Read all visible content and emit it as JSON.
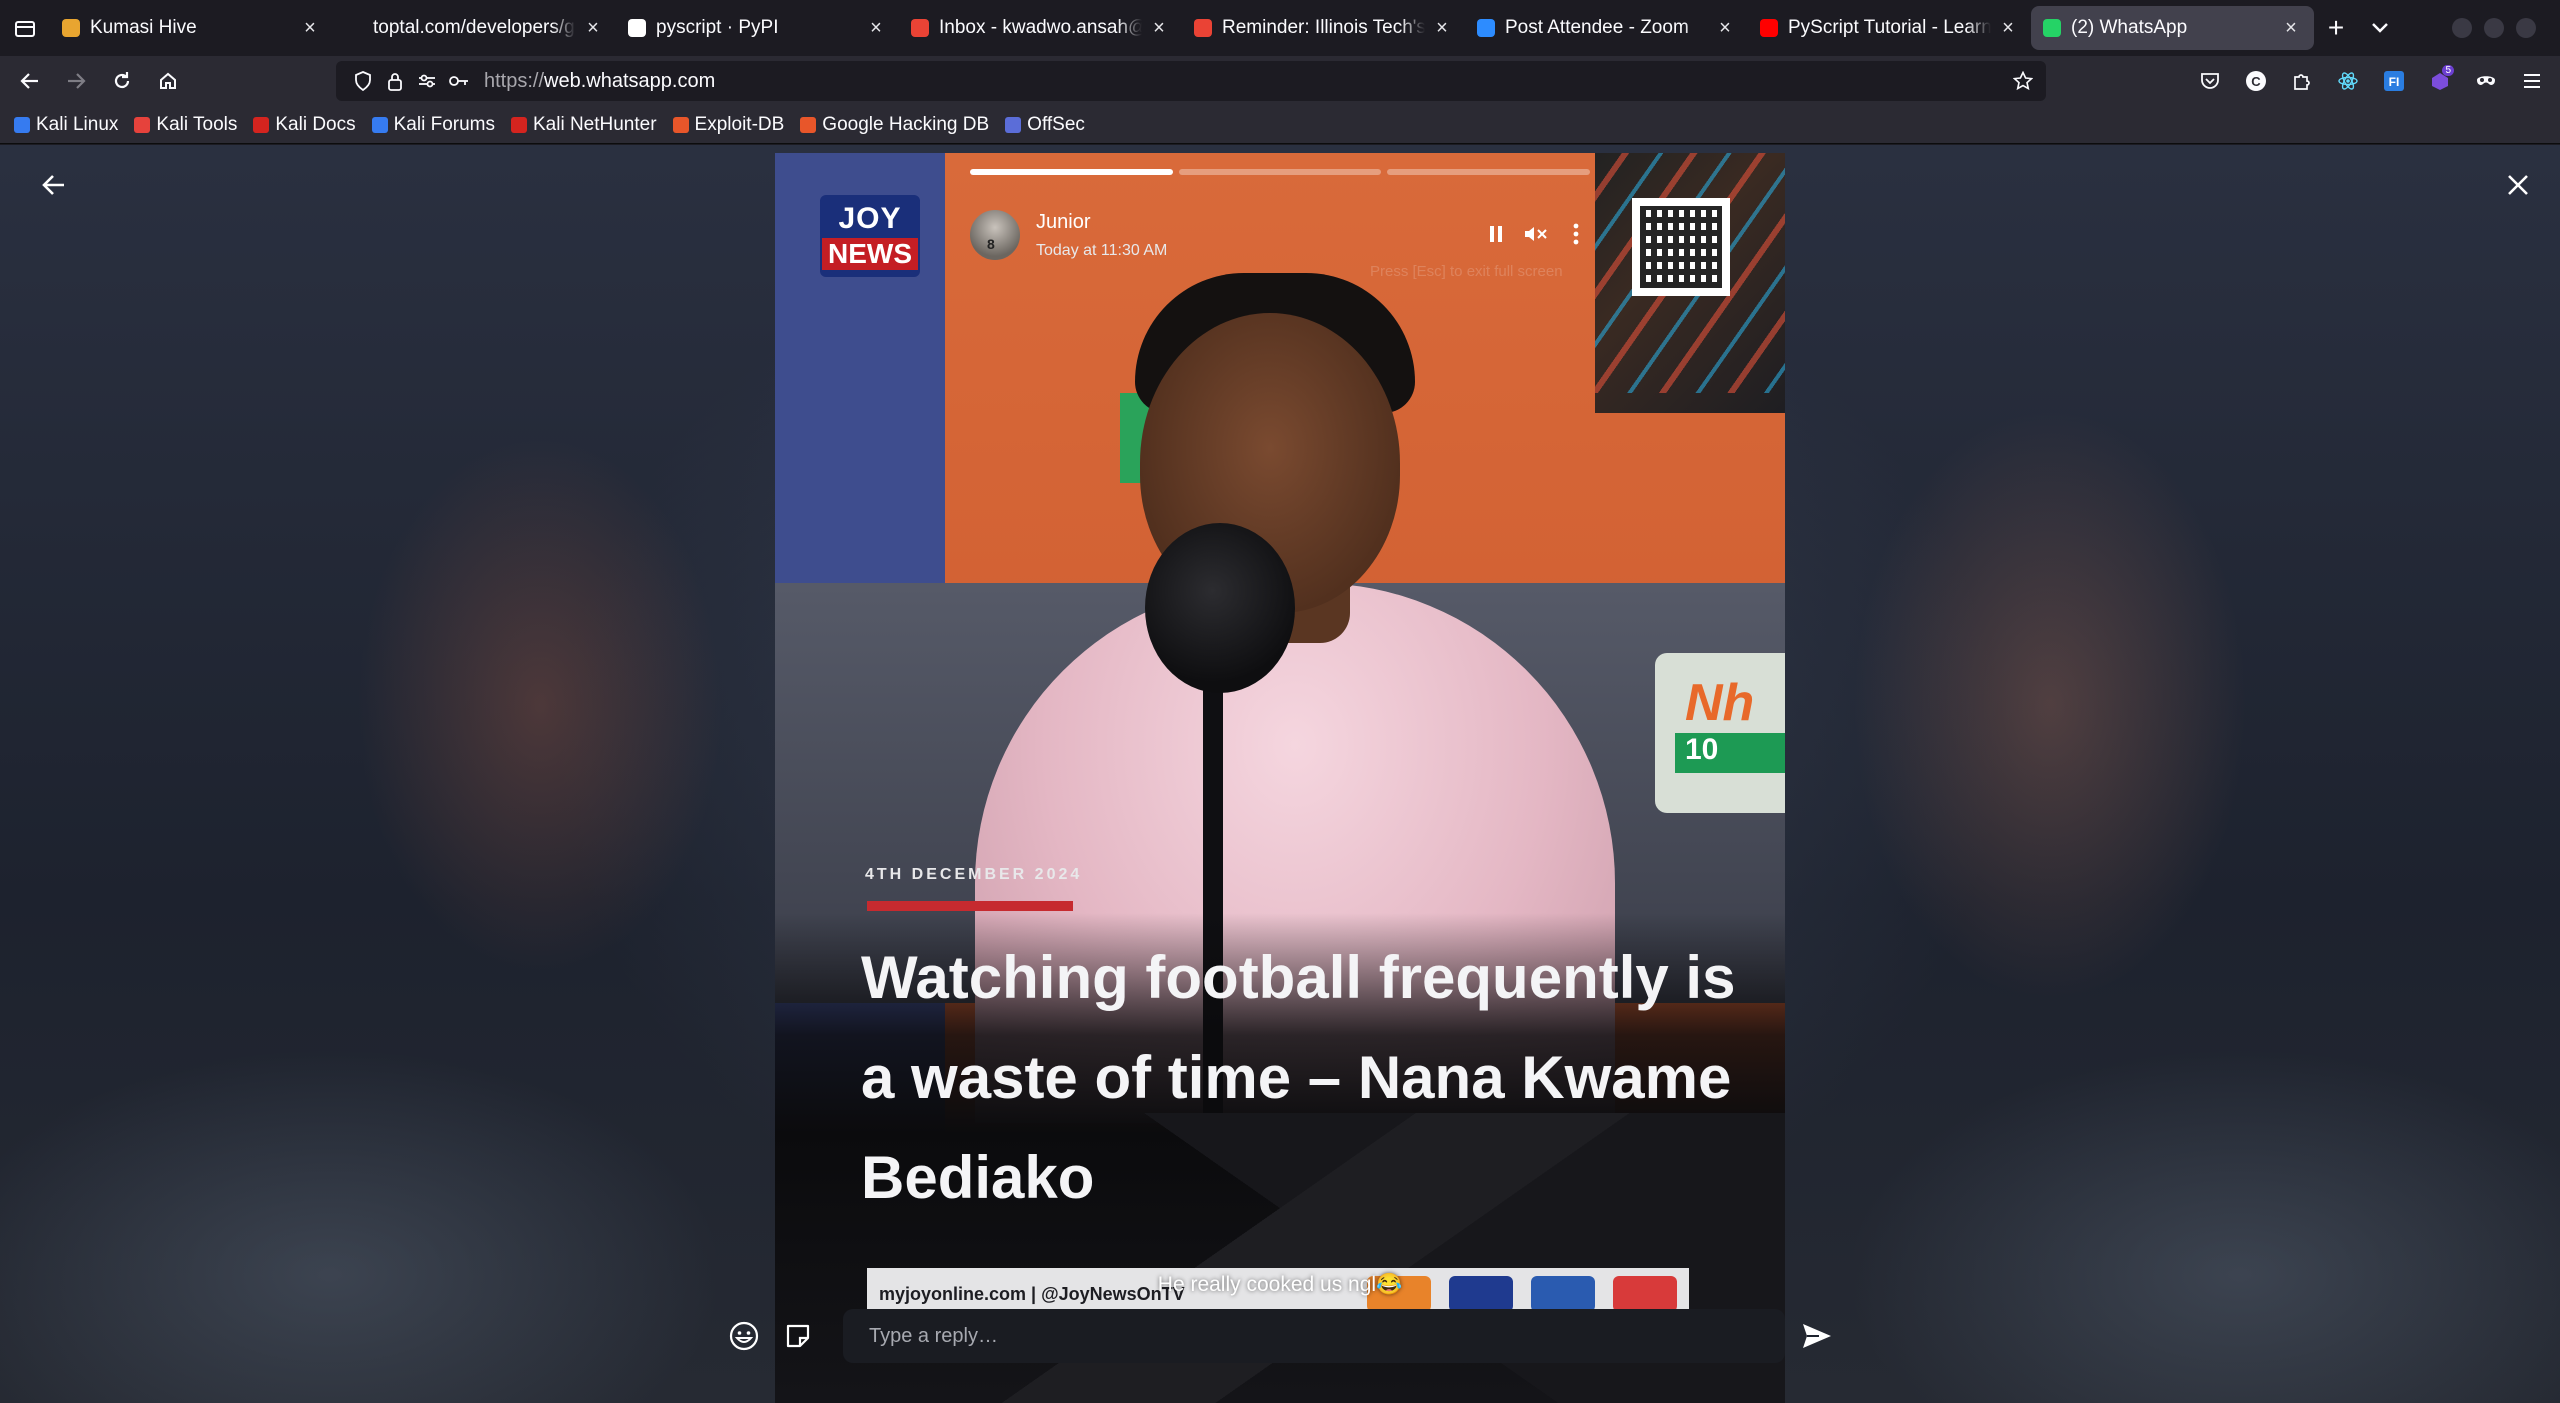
{
  "browser": {
    "tabs": [
      {
        "title": "Kumasi Hive",
        "favicon": "hive-favicon",
        "color": "#e8a530",
        "active": false
      },
      {
        "title": "toptal.com/developers/gitign",
        "favicon": "none",
        "color": "#1c1b22",
        "active": false
      },
      {
        "title": "pyscript · PyPI",
        "favicon": "pypi-favicon",
        "color": "#ffffff",
        "active": false
      },
      {
        "title": "Inbox - kwadwo.ansah@",
        "favicon": "gmail-favicon",
        "color": "#ea4335",
        "active": false
      },
      {
        "title": "Reminder: Illinois Tech's I",
        "favicon": "gmail-favicon",
        "color": "#ea4335",
        "active": false
      },
      {
        "title": "Post Attendee - Zoom",
        "favicon": "zoom-favicon",
        "color": "#2d8cff",
        "active": false
      },
      {
        "title": "PyScript Tutorial - Learn I",
        "favicon": "youtube-favicon",
        "color": "#ff0000",
        "active": false
      },
      {
        "title": "(2) WhatsApp",
        "favicon": "whatsapp-favicon",
        "color": "#25d366",
        "active": true
      }
    ],
    "url": {
      "scheme": "https://",
      "sub": "web.",
      "host": "whatsapp.com"
    },
    "bookmarks": [
      {
        "label": "Kali Linux",
        "color": "#367bf0"
      },
      {
        "label": "Kali Tools",
        "color": "#e6423c"
      },
      {
        "label": "Kali Docs",
        "color": "#d4241f"
      },
      {
        "label": "Kali Forums",
        "color": "#367bf0"
      },
      {
        "label": "Kali NetHunter",
        "color": "#d4241f"
      },
      {
        "label": "Exploit-DB",
        "color": "#e8562a"
      },
      {
        "label": "Google Hacking DB",
        "color": "#e8562a"
      },
      {
        "label": "OffSec",
        "color": "#5b6dd8"
      }
    ],
    "extensions_badge": "5"
  },
  "status_viewer": {
    "progress": [
      1.0,
      0.0,
      0.0
    ],
    "contact_name": "Junior",
    "avatar_number": "8",
    "timestamp": "Today at 11:30 AM",
    "hint": "Press [Esc] to exit full screen",
    "media": {
      "channel_logo_top": "JOY",
      "channel_logo_bottom": "NEWS",
      "date": "4TH DECEMBER 2024",
      "headline": "Watching football frequently is a waste of time – Nana Kwame Bediako",
      "site": "myjoyonline.com  |  @JoyNewsOnTV",
      "station_sign": "Nh",
      "station_freq": "10"
    },
    "caption": "He really cooked us ngl😂",
    "reply_placeholder": "Type a reply…"
  },
  "colors": {
    "accent_red": "#c62a2f",
    "joy_blue": "#1a2f7a",
    "whatsapp_green": "#25d366"
  }
}
